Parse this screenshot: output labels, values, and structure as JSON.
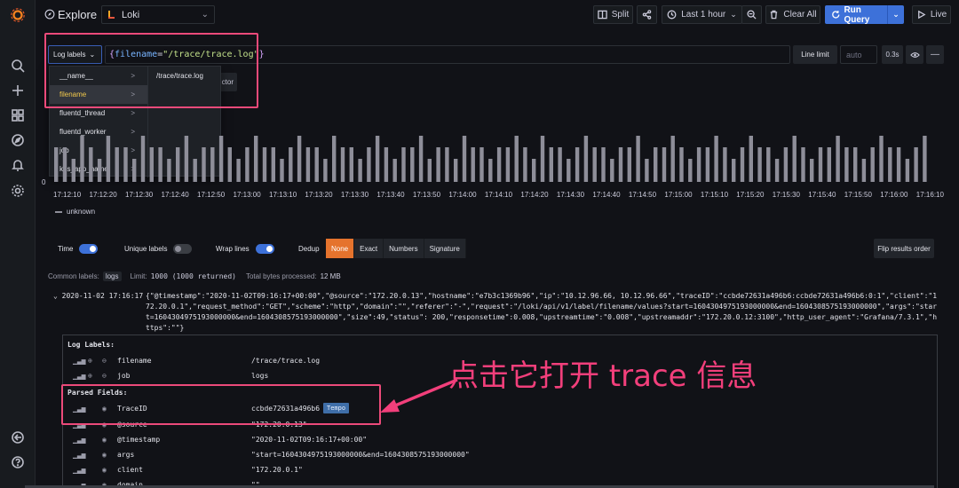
{
  "app": {
    "title": "Explore",
    "datasource": "Loki"
  },
  "toolbar": {
    "split_label": "Split",
    "time_range_label": "Last 1 hour",
    "clear_all_label": "Clear All",
    "run_query_label": "Run Query",
    "live_label": "Live"
  },
  "query": {
    "log_labels_label": "Log labels",
    "open_brace": "{",
    "key": "filename",
    "operator": "=",
    "value": "\"/trace/trace.log\"",
    "close_brace": "}",
    "line_limit_label": "Line limit",
    "line_limit_placeholder": "auto",
    "query_time": "0.3s"
  },
  "label_browser": {
    "labels": [
      {
        "name": "__name__",
        "active": false
      },
      {
        "name": "filename",
        "active": true
      },
      {
        "name": "fluentd_thread",
        "active": false
      },
      {
        "name": "fluentd_worker",
        "active": false
      },
      {
        "name": "job",
        "active": false
      },
      {
        "name": "k8s_app_name",
        "active": false
      }
    ],
    "values": [
      "/trace/trace.log"
    ],
    "partial_button_text": "ctor"
  },
  "chart_data": {
    "type": "bar",
    "x_ticks": [
      "17:12:10",
      "17:12:20",
      "17:12:30",
      "17:12:40",
      "17:12:50",
      "17:13:00",
      "17:13:10",
      "17:13:20",
      "17:13:30",
      "17:13:40",
      "17:13:50",
      "17:14:00",
      "17:14:10",
      "17:14:20",
      "17:14:30",
      "17:14:40",
      "17:14:50",
      "17:15:00",
      "17:15:10",
      "17:15:20",
      "17:15:30",
      "17:15:40",
      "17:15:50",
      "17:16:00",
      "17:16:10"
    ],
    "y_tick": "0",
    "series": [
      {
        "name": "unknown",
        "values": [
          3,
          3,
          2,
          4,
          3,
          2,
          4,
          3,
          3,
          2,
          4,
          3,
          3,
          2,
          3,
          4,
          2,
          3,
          3,
          4,
          3,
          2,
          3,
          4,
          3,
          3,
          2,
          3,
          4,
          3,
          3,
          2,
          4,
          3,
          3,
          2,
          3,
          4,
          3,
          2,
          3,
          3,
          4,
          2,
          3,
          3,
          2,
          4,
          3,
          3,
          2,
          3,
          3,
          4,
          3,
          2,
          4,
          3,
          3,
          2,
          3,
          4,
          3,
          3,
          2,
          3,
          3,
          4,
          2,
          3,
          3,
          4,
          3,
          2,
          3,
          3,
          4,
          3,
          2,
          3,
          4,
          3,
          3,
          2,
          3,
          4,
          3,
          2,
          3,
          3,
          4,
          3,
          3,
          2,
          3,
          4,
          3,
          3,
          2,
          3,
          4
        ]
      }
    ],
    "legend_placement": "bottom-left"
  },
  "options": {
    "time_label": "Time",
    "time_on": true,
    "unique_labels_label": "Unique labels",
    "unique_on": false,
    "wrap_lines_label": "Wrap lines",
    "wrap_on": true,
    "dedup_label": "Dedup",
    "dedup_options": [
      "None",
      "Exact",
      "Numbers",
      "Signature"
    ],
    "dedup_selected": "None",
    "flip_label": "Flip results order"
  },
  "stats": {
    "common_labels_label": "Common labels:",
    "common_labels_value": "logs",
    "limit_label": "Limit:",
    "limit_value": "1000 (1000 returned)",
    "bytes_label": "Total bytes processed:",
    "bytes_value": "12 MB"
  },
  "log": {
    "timestamp": "2020-11-02 17:16:17",
    "message": "{\"@timestamp\":\"2020-11-02T09:16:17+00:00\",\"@source\":\"172.20.0.13\",\"hostname\":\"e7b3c1369b96\",\"ip\":\"10.12.96.66, 10.12.96.66\",\"traceID\":\"ccbde72631a496b6:ccbde72631a496b6:0:1\",\"client\":\"172.20.0.1\",\"request_method\":\"GET\",\"scheme\":\"http\",\"domain\":\"\",\"referer\":\"-\",\"request\":\"/loki/api/v1/label/filename/values?start=1604304975193000000&end=1604308575193000000\",\"args\":\"start=1604304975193000000&end=1604308575193000000\",\"size\":49,\"status\": 200,\"responsetime\":0.008,\"upstreamtime\":\"0.008\",\"upstreamaddr\":\"172.20.0.12:3100\",\"http_user_agent\":\"Grafana/7.3.1\",\"https\":\"\"}"
  },
  "details": {
    "log_labels_title": "Log Labels:",
    "log_labels": [
      {
        "key": "filename",
        "value": "/trace/trace.log"
      },
      {
        "key": "job",
        "value": "logs"
      }
    ],
    "parsed_fields_title": "Parsed Fields:",
    "parsed_fields": [
      {
        "key": "TraceID",
        "value": "ccbde72631a496b6"
      },
      {
        "key": "@source",
        "value": "\"172.20.0.13\""
      },
      {
        "key": "@timestamp",
        "value": "\"2020-11-02T09:16:17+00:00\""
      },
      {
        "key": "args",
        "value": "\"start=1604304975193000000&end=1604308575193000000\""
      },
      {
        "key": "client",
        "value": "\"172.20.0.1\""
      },
      {
        "key": "domain",
        "value": "\"\""
      }
    ],
    "tempo_label": "Tempo"
  },
  "annotation": {
    "text": "点击它打开 trace 信息",
    "color": "#f23f7b"
  },
  "colors": {
    "accent": "#3d71d9",
    "dedup_active": "#e5732d",
    "highlight": "#ec4a7a",
    "background": "#111217"
  }
}
